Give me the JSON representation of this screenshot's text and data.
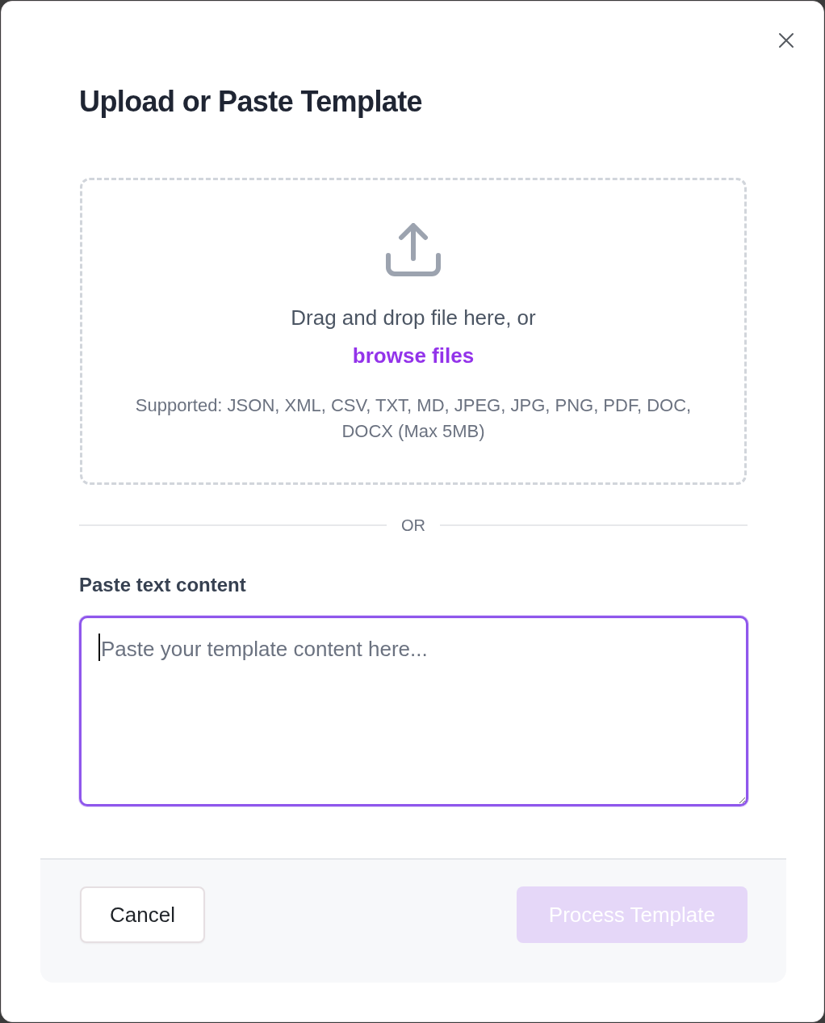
{
  "dialog": {
    "title": "Upload or Paste Template"
  },
  "drop_zone": {
    "prompt": "Drag and drop file here, or",
    "link": "browse files",
    "supported": "Supported: JSON, XML, CSV, TXT, MD, JPEG, JPG, PNG, PDF, DOC, DOCX (Max 5MB)"
  },
  "divider": {
    "label": "OR"
  },
  "paste_field": {
    "label": "Paste text content",
    "placeholder": "Paste your template content here...",
    "focused": true
  },
  "footer": {
    "buttons": [
      {
        "label": "Cancel",
        "kind": "secondary",
        "disabled": false
      },
      {
        "label": "Process Template",
        "kind": "primary",
        "disabled": true
      }
    ]
  }
}
